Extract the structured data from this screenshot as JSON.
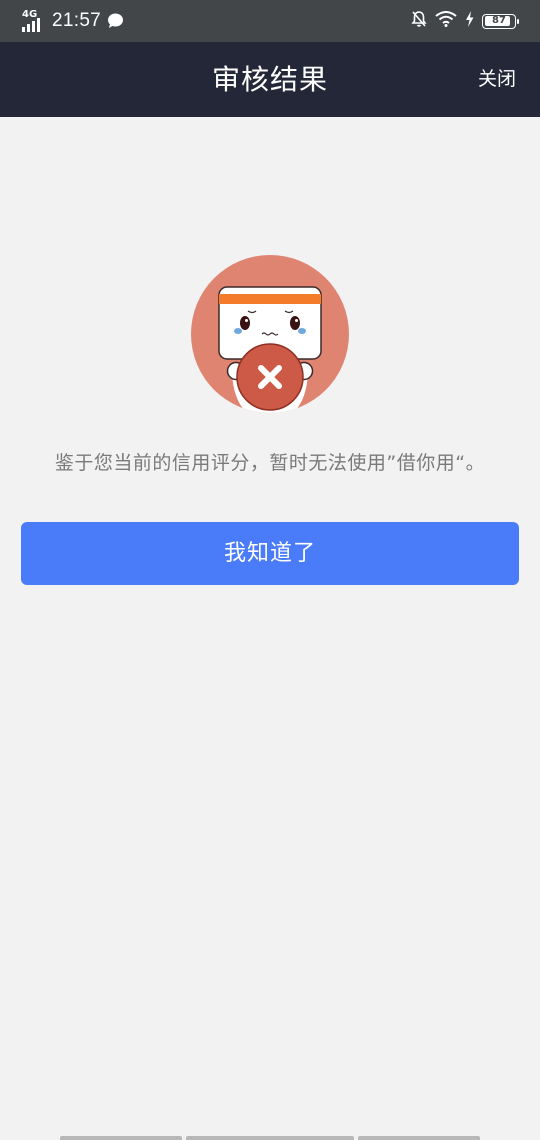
{
  "status_bar": {
    "network": "4G",
    "time": "21:57",
    "battery_level": "87",
    "battery_fraction": 0.87,
    "icons": [
      "signal-icon",
      "message-icon",
      "mute-bell-icon",
      "wifi-icon",
      "charging-icon",
      "battery-icon"
    ]
  },
  "nav": {
    "title": "审核结果",
    "close_label": "关闭"
  },
  "main": {
    "message": "鉴于您当前的信用评分，暂时无法使用”借你用“。",
    "button_label": "我知道了"
  },
  "colors": {
    "status_bar_bg": "#434649",
    "nav_bg": "#242737",
    "page_bg": "#f2f2f2",
    "button_bg": "#4a7cfa",
    "illustration_circle": "#e08472",
    "headband": "#f47b2a",
    "reject_circle": "#cc5a47"
  }
}
